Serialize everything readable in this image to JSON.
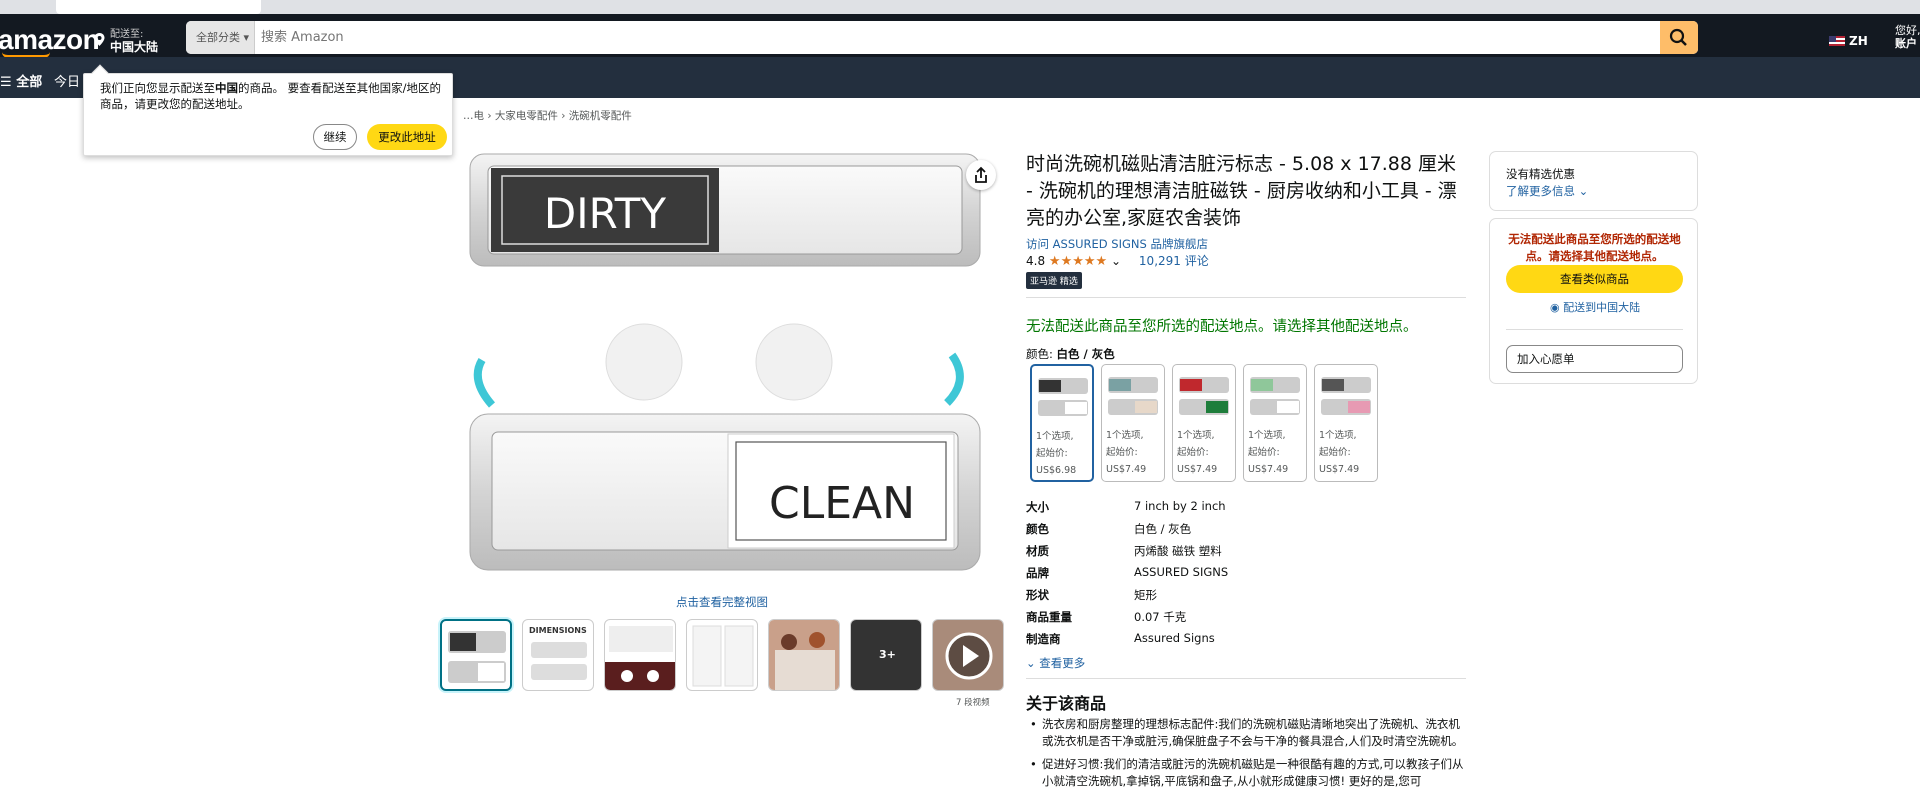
{
  "header": {
    "logo": "amazon",
    "deliver_line1": "配送至:",
    "deliver_line2": "中国大陆",
    "search_category": "全部分类",
    "search_placeholder": "搜索 Amazon",
    "language": "ZH",
    "account_line1": "您好,",
    "account_line2": "账户"
  },
  "nav": {
    "all_label": "全部",
    "today_label": "今日"
  },
  "popup": {
    "message_parts": [
      "我们正向您显示配送至",
      "中国",
      "的商品。 要查看配送至其他国家/地区的商品，请更改您的配送地址。"
    ],
    "continue_label": "继续",
    "change_label": "更改此地址"
  },
  "breadcrumb": [
    "…电",
    "大家电零配件",
    "洗碗机零配件"
  ],
  "gallery": {
    "dirty_text": "DIRTY",
    "clean_text": "CLEAN",
    "full_view_label": "点击查看完整视图",
    "dimensions_label": "DIMENSIONS",
    "more_images": "3+",
    "video_count_label": "7 段视频"
  },
  "product": {
    "title": "时尚洗碗机磁贴清洁脏污标志 - 5.08 x 17.88 厘米 - 洗碗机的理想清洁脏磁铁 - 厨房收纳和小工具 - 漂亮的办公室,家庭农舍装饰",
    "store_link": "访问 ASSURED SIGNS 品牌旗舰店",
    "rating": "4.8",
    "stars": "★★★★★",
    "review_count": "10,291 评论",
    "badge": "亚马逊 精选",
    "unavailable_msg": "无法配送此商品至您所选的配送地点。请选择其他配送地点。",
    "color_label": "颜色:",
    "color_value": "白色 / 灰色",
    "swatches": [
      {
        "options": "1个选项,",
        "from": "起始价:",
        "price": "US$6.98"
      },
      {
        "options": "1个选项,",
        "from": "起始价:",
        "price": "US$7.49"
      },
      {
        "options": "1个选项,",
        "from": "起始价:",
        "price": "US$7.49"
      },
      {
        "options": "1个选项,",
        "from": "起始价:",
        "price": "US$7.49"
      },
      {
        "options": "1个选项,",
        "from": "起始价:",
        "price": "US$7.49"
      }
    ],
    "specs": [
      {
        "k": "大小",
        "v": "7 inch by 2 inch"
      },
      {
        "k": "颜色",
        "v": "白色 / 灰色"
      },
      {
        "k": "材质",
        "v": "丙烯酸 磁铁 塑料"
      },
      {
        "k": "品牌",
        "v": "ASSURED SIGNS"
      },
      {
        "k": "形状",
        "v": "矩形"
      },
      {
        "k": "商品重量",
        "v": "0.07 千克"
      },
      {
        "k": "制造商",
        "v": "Assured Signs"
      }
    ],
    "see_more": "查看更多",
    "about_title": "关于该商品",
    "bullets": [
      "洗衣房和厨房整理的理想标志配件:我们的洗碗机磁贴清晰地突出了洗碗机、洗衣机或洗衣机是否干净或脏污,确保脏盘子不会与干净的餐具混合,人们及时清空洗碗机。",
      "促进好习惯:我们的清洁或脏污的洗碗机磁贴是一种很酷有趣的方式,可以教孩子们从小就清空洗碗机,拿掉锅,平底锅和盘子,从小就形成健康习惯! 更好的是,您可"
    ]
  },
  "buybox": {
    "deals_title": "没有精选优惠",
    "learn_more": "了解更多信息",
    "warning": "无法配送此商品至您所选的配送地点。请选择其他配送地点。",
    "see_similar": "查看类似商品",
    "ship_to": "配送到中国大陆",
    "wishlist": "加入心愿单"
  },
  "colors": {
    "header_bg": "#131921",
    "nav_bg": "#232f3e",
    "accent_orange": "#ff9900",
    "button_yellow": "#ffd814",
    "link_blue": "#2162a1",
    "green": "#007600",
    "red": "#b12704"
  }
}
